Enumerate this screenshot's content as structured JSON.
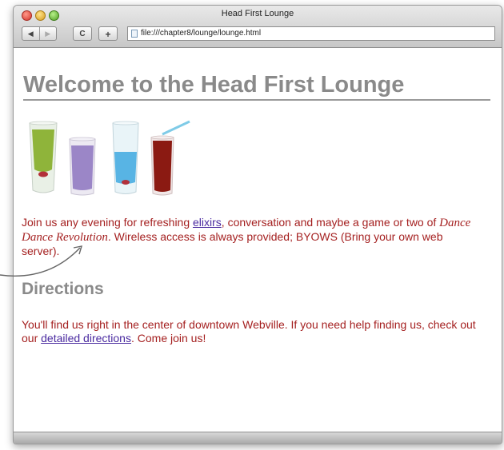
{
  "window": {
    "title": "Head First Lounge",
    "url": "file:///chapter8/lounge/lounge.html"
  },
  "toolbar": {
    "back_icon": "◀",
    "forward_icon": "▶",
    "reload_icon": "C",
    "add_icon": "+"
  },
  "page": {
    "heading": "Welcome to the Head First Lounge",
    "intro_before_link": "Join us any evening for refreshing ",
    "intro_link": "elixirs",
    "intro_middle": ", conversation and maybe a game or two of ",
    "intro_emphasis": "Dance Dance Revolution",
    "intro_after": ". Wireless access is always provided; BYOWS (Bring your own web server).",
    "directions_heading": "Directions",
    "directions_before_link": "You'll find us right in the center of downtown Webville. If you need help finding us, check out our ",
    "directions_link": "detailed directions",
    "directions_after": ". Come join us!"
  },
  "colors": {
    "heading": "#8a8a8a",
    "body_text": "#a41f1f",
    "link": "#4a2aa0"
  }
}
